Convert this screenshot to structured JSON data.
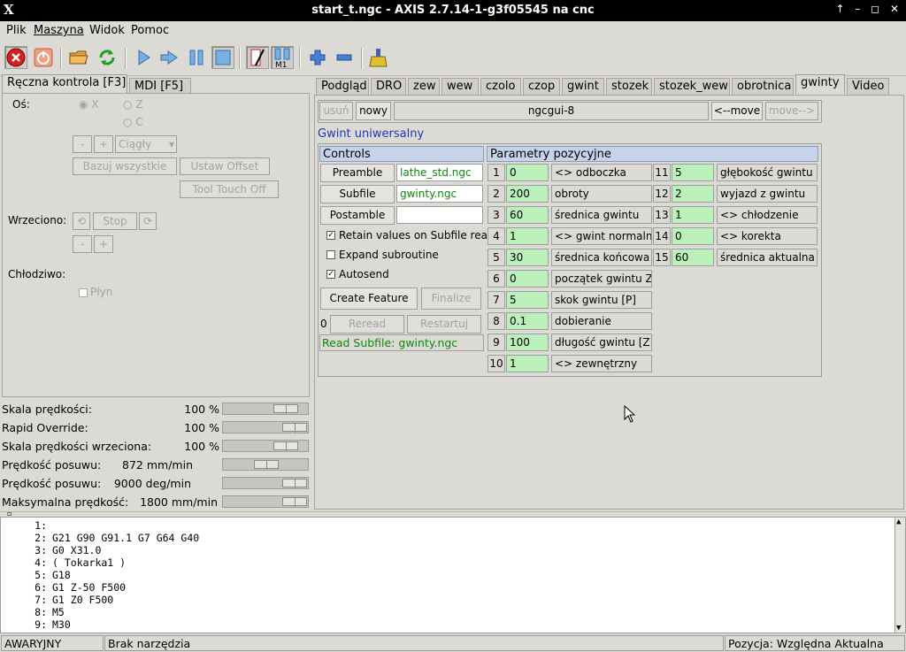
{
  "window": {
    "title": "start_t.ngc - AXIS 2.7.14-1-g3f05545 na cnc",
    "logo": "X",
    "controls": "↑ – ◻ ✕"
  },
  "menu": [
    "Plik",
    "Maszyna",
    "Widok",
    "Pomoc"
  ],
  "toolbar": {
    "icons": [
      "estop-icon",
      "power-icon",
      "open-file-icon",
      "reload-icon",
      "run-icon",
      "step-icon",
      "pause-icon",
      "stop-icon",
      "optional-block-icon",
      "optional-stop-icon",
      "zoom-in-icon",
      "zoom-out-icon",
      "clear-plot-icon"
    ],
    "m1_label": "M1"
  },
  "left_tabs": [
    "Ręczna kontrola [F3]",
    "MDI [F5]"
  ],
  "manual": {
    "axis_label": "Oś:",
    "axes": [
      "X",
      "Z",
      "C"
    ],
    "jog_minus": "-",
    "jog_plus": "+",
    "jog_mode": "Ciągły",
    "home_all": "Bazuj wszystkie",
    "touch_off": "Ustaw Offset",
    "tool_touch_off": "Tool Touch Off",
    "spindle_label": "Wrzeciono:",
    "spindle_stop": "Stop",
    "spindle_minus": "-",
    "spindle_plus": "+",
    "coolant_label": "Chłodziwo:",
    "flood": "Płyn"
  },
  "overrides": [
    {
      "label": "Skala prędkości:",
      "value": "100 %",
      "level": 0.75
    },
    {
      "label": "Rapid Override:",
      "value": "100 %",
      "level": 0.85
    },
    {
      "label": "Skala prędkości wrzeciona:",
      "value": "100 %",
      "level": 0.75
    },
    {
      "label": "Prędkość posuwu:",
      "value": "872 mm/min",
      "level": 0.5
    },
    {
      "label": "Prędkość posuwu:",
      "value": "9000 deg/min",
      "level": 0.85
    },
    {
      "label": "Maksymalna prędkość:",
      "value": "1800 mm/min",
      "level": 0.85
    }
  ],
  "right_tabs": [
    "Podgląd",
    "DRO",
    "zew",
    "wew",
    "czolo",
    "czop",
    "gwint",
    "stozek",
    "stozek_wew",
    "obrotnica",
    "gwinty",
    "Video"
  ],
  "active_tab": "gwinty",
  "ngcgui": {
    "remove": "usuń",
    "new": "nowy",
    "page": "ngcgui-8",
    "move_left": "<--move",
    "move_right": "move-->",
    "feature_title": "Gwint uniwersalny",
    "controls_header": "Controls",
    "preamble_btn": "Preamble",
    "preamble_file": "lathe_std.ngc",
    "subfile_btn": "Subfile",
    "subfile_file": "gwinty.ngc",
    "postamble_btn": "Postamble",
    "postamble_file": "",
    "retain": "Retain values on Subfile read",
    "expand": "Expand subroutine",
    "autosend": "Autosend",
    "create": "Create Feature",
    "finalize": "Finalize",
    "counter": "0",
    "reread": "Reread",
    "restart": "Restartuj",
    "status": "Read Subfile: gwinty.ngc",
    "params_header": "Parametry pozycyjne",
    "params_left": [
      {
        "n": "1",
        "v": "0",
        "l": "<> odboczka"
      },
      {
        "n": "2",
        "v": "200",
        "l": "obroty"
      },
      {
        "n": "3",
        "v": "60",
        "l": "średnica gwintu"
      },
      {
        "n": "4",
        "v": "1",
        "l": "<> gwint normalny"
      },
      {
        "n": "5",
        "v": "30",
        "l": "średnica końcowa X"
      },
      {
        "n": "6",
        "v": "0",
        "l": "początek gwintu Z"
      },
      {
        "n": "7",
        "v": "5",
        "l": "skok gwintu [P]"
      },
      {
        "n": "8",
        "v": "0.1",
        "l": "dobieranie"
      },
      {
        "n": "9",
        "v": "100",
        "l": "długość gwintu [Z]"
      },
      {
        "n": "10",
        "v": "1",
        "l": "<> zewnętrzny"
      }
    ],
    "params_right": [
      {
        "n": "11",
        "v": "5",
        "l": "głębokość gwintu"
      },
      {
        "n": "12",
        "v": "2",
        "l": "wyjazd z gwintu"
      },
      {
        "n": "13",
        "v": "1",
        "l": "<> chłodzenie"
      },
      {
        "n": "14",
        "v": "0",
        "l": "<> korekta"
      },
      {
        "n": "15",
        "v": "60",
        "l": "średnica aktualna X"
      }
    ]
  },
  "gcode": [
    {
      "n": "1:",
      "t": ""
    },
    {
      "n": "2:",
      "t": "G21 G90 G91.1 G7 G64 G40"
    },
    {
      "n": "3:",
      "t": "G0 X31.0"
    },
    {
      "n": "4:",
      "t": "( Tokarka1 )"
    },
    {
      "n": "5:",
      "t": "G18"
    },
    {
      "n": "6:",
      "t": "G1 Z-50 F500"
    },
    {
      "n": "7:",
      "t": "G1 Z0 F500"
    },
    {
      "n": "8:",
      "t": "M5"
    },
    {
      "n": "9:",
      "t": "M30"
    }
  ],
  "statusbar": {
    "state": "AWARYJNY",
    "tool": "Brak narzędzia",
    "position": "Pozycja: Względna Aktualna"
  }
}
